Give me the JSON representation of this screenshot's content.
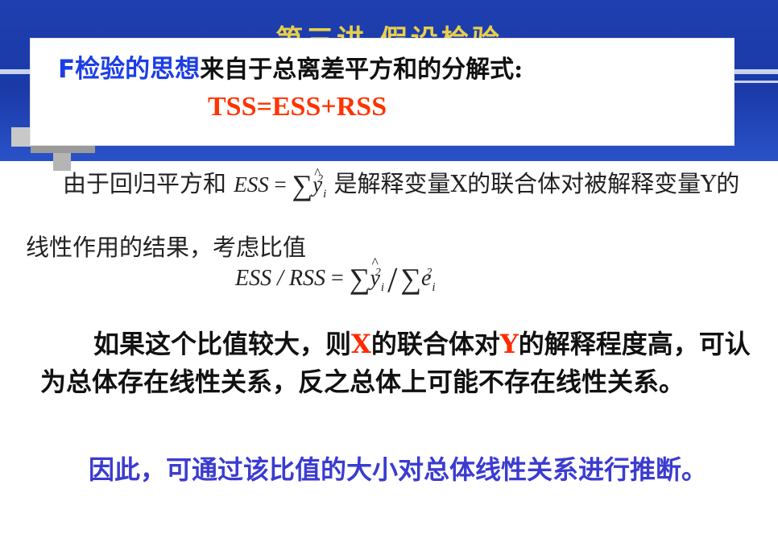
{
  "header": {
    "title": "第三讲 假设检验"
  },
  "callout": {
    "highlight": "F检验的思想",
    "rest": "来自于总离差平方和的分解式:",
    "formula": "TSS=ESS+RSS"
  },
  "para1": {
    "part1": "由于回归平方和",
    "math_lhs": "ESS",
    "eq": "=",
    "sum": "∑",
    "y": "y",
    "sub_i": "i",
    "sup_2": "2",
    "part2": "是解释变量X的联合体对被解释变量Y的线性作用的结果，考虑比值"
  },
  "equation": {
    "lhs": "ESS / RSS",
    "eq": "=",
    "sum1": "∑",
    "y": "y",
    "sub_i": "i",
    "sup_2": "2",
    "slash": "/",
    "sum2": "∑",
    "e": "e",
    "sub_i2": "i",
    "sup_2b": "2"
  },
  "para2": {
    "part1": "如果这个比值较大，则",
    "X": "X",
    "part2": "的联合体对",
    "Y": "Y",
    "part3": "的解释程度高，可认为总体存在线性关系，反之总体上可能不存在线性关系。"
  },
  "para3": {
    "text": "因此，可通过该比值的大小对总体线性关系进行推断。"
  },
  "colors": {
    "header_blue": "#1f3fb0",
    "title_yellow": "#e8d04a",
    "highlight_blue": "#1d3de6",
    "formula_red": "#ff3300",
    "conclusion_blue": "#3b3bd1"
  }
}
